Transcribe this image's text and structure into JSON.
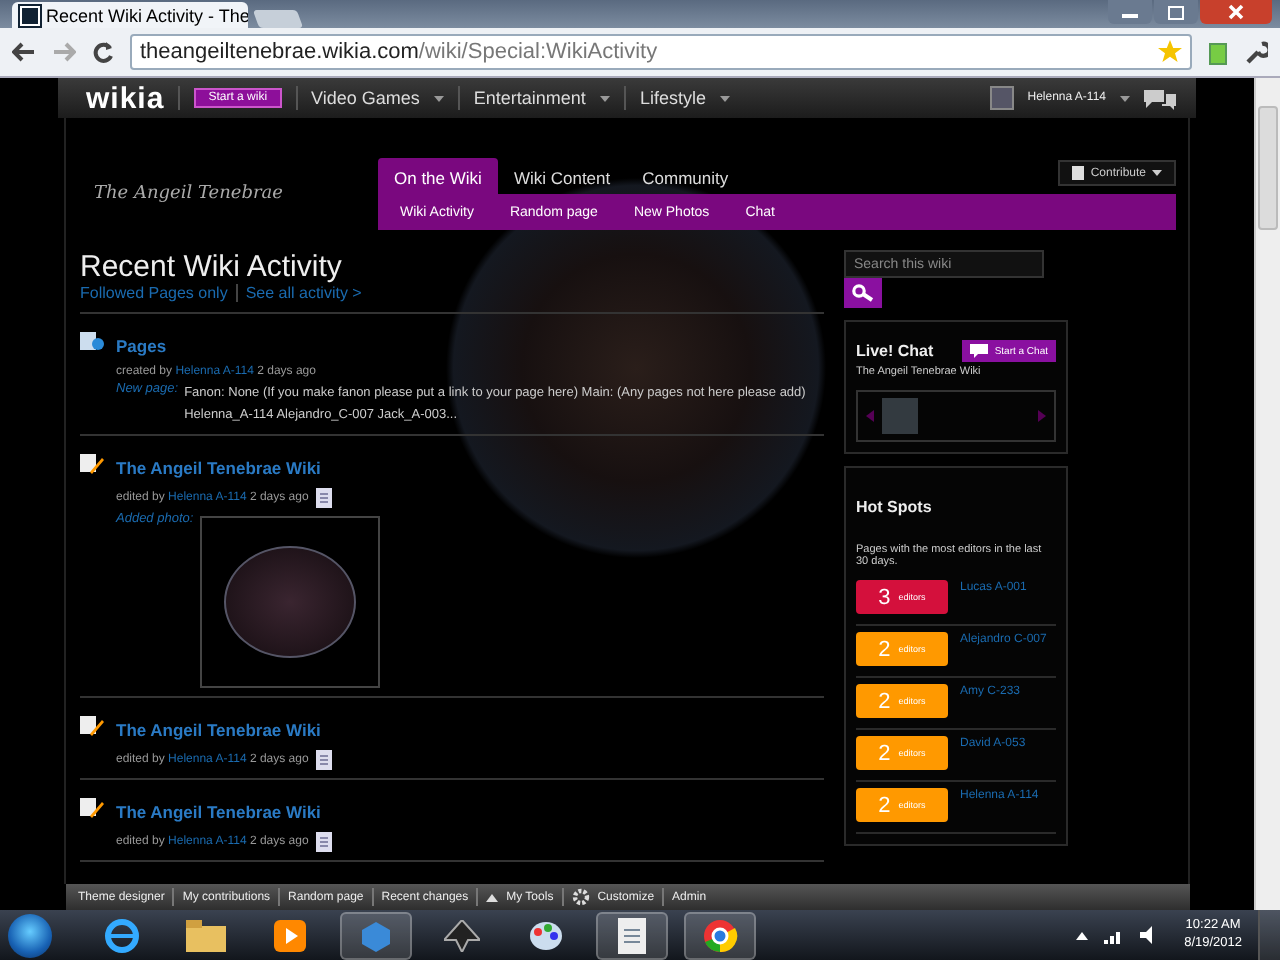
{
  "browser": {
    "tab_title": "Recent Wiki Activity - The",
    "url_host": "theangeiltenebrae.wikia.com",
    "url_path": "/wiki/Special:WikiActivity"
  },
  "wikia_bar": {
    "logo": "wikia",
    "start_button": "Start a wiki",
    "menus": [
      "Video Games",
      "Entertainment",
      "Lifestyle"
    ],
    "user": "Helenna A-114"
  },
  "wiki_header": {
    "name": "The Angeil Tenebrae",
    "contribute": "Contribute",
    "tabs": [
      {
        "label": "On the Wiki",
        "selected": true
      },
      {
        "label": "Wiki Content",
        "selected": false
      },
      {
        "label": "Community",
        "selected": false
      }
    ],
    "subnav": [
      "Wiki Activity",
      "Random page",
      "New Photos",
      "Chat"
    ]
  },
  "activity": {
    "title": "Recent Wiki Activity",
    "filters": [
      "Followed Pages only",
      "See all activity >"
    ],
    "items": [
      {
        "kind": "new",
        "title": "Pages",
        "verb": "created by",
        "user": "Helenna A-114",
        "time": "2 days ago",
        "detail_label": "New page:",
        "detail_text": "Fanon: None (If you make fanon please put a link to your page here) Main: (Any pages not here please add) Helenna_A-114 Alejandro_C-007 Jack_A-003..."
      },
      {
        "kind": "photo",
        "title": "The Angeil Tenebrae Wiki",
        "verb": "edited by",
        "user": "Helenna A-114",
        "time": "2 days ago",
        "detail_label": "Added photo:"
      },
      {
        "kind": "edit",
        "title": "The Angeil Tenebrae Wiki",
        "verb": "edited by",
        "user": "Helenna A-114",
        "time": "2 days ago"
      },
      {
        "kind": "edit",
        "title": "The Angeil Tenebrae Wiki",
        "verb": "edited by",
        "user": "Helenna A-114",
        "time": "2 days ago"
      }
    ]
  },
  "sidebar": {
    "search": {
      "placeholder": "Search this wiki"
    },
    "chat": {
      "title": "Live! Chat",
      "button": "Start a Chat",
      "wiki": "The Angeil Tenebrae Wiki"
    },
    "hot_spots": {
      "title": "Hot Spots",
      "subtitle": "Pages with the most editors in the last 30 days.",
      "items": [
        {
          "count": "3",
          "unit": "editors",
          "page": "Lucas A-001",
          "color": "#d4103c"
        },
        {
          "count": "2",
          "unit": "editors",
          "page": "Alejandro C-007",
          "color": "#ff9900"
        },
        {
          "count": "2",
          "unit": "editors",
          "page": "Amy C-233",
          "color": "#ff9900"
        },
        {
          "count": "2",
          "unit": "editors",
          "page": "David A-053",
          "color": "#ff9900"
        },
        {
          "count": "2",
          "unit": "editors",
          "page": "Helenna A-114",
          "color": "#ff9900"
        }
      ]
    }
  },
  "toolbar": [
    "Theme designer",
    "My contributions",
    "Random page",
    "Recent changes",
    "My Tools",
    "Customize",
    "Admin"
  ],
  "taskbar": {
    "time": "10:22 AM",
    "date": "8/19/2012"
  }
}
